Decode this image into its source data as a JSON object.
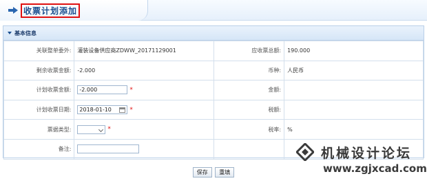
{
  "header": {
    "title": "收票计划添加"
  },
  "section": {
    "title": "基本信息"
  },
  "form": {
    "related_doc": {
      "label": "关联整单委外:",
      "value": "灌装设备供应商ZDWW_20171129001"
    },
    "total_receivable": {
      "label": "应收票总额:",
      "value": "190.000"
    },
    "remaining_amount": {
      "label": "剩余收票金额:",
      "value": "-2.000"
    },
    "currency": {
      "label": "币种:",
      "value": "人民币"
    },
    "planned_amount": {
      "label": "计划收票金额:",
      "value": "-2.000"
    },
    "amount": {
      "label": "金额:",
      "value": ""
    },
    "planned_date": {
      "label": "计划收票日期:",
      "value": "2018-01-10"
    },
    "tax_amount": {
      "label": "税额:",
      "value": ""
    },
    "invoice_type": {
      "label": "票据类型:",
      "value": ""
    },
    "tax_rate": {
      "label": "税率:",
      "value": "%"
    },
    "remarks": {
      "label": "备注:",
      "value": ""
    },
    "required_mark": "*"
  },
  "buttons": {
    "save": "保存",
    "reset": "重填"
  },
  "watermark": {
    "line1": "机械设计论坛",
    "line2": "www.zgjxcad.com"
  },
  "colors": {
    "title": "#1a4e8f",
    "required": "#e01010",
    "border_highlight": "#e01010"
  }
}
